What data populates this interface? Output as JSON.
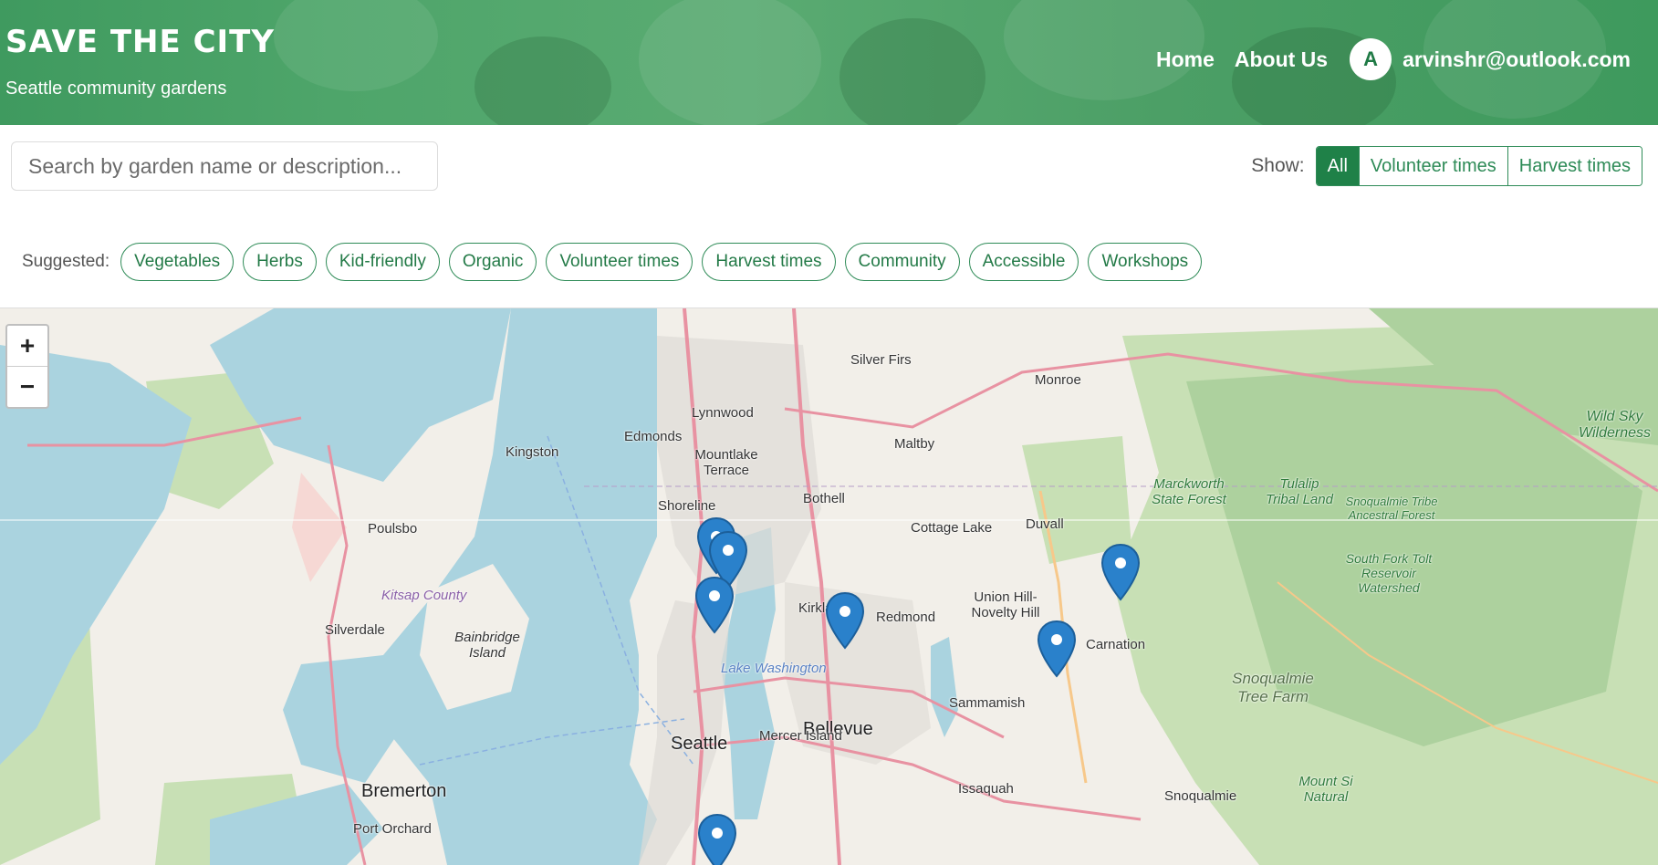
{
  "header": {
    "title": "Save the City",
    "subtitle": "Seattle community gardens",
    "nav": [
      {
        "label": "Home"
      },
      {
        "label": "About Us"
      }
    ],
    "user": {
      "initial": "A",
      "email": "arvinshr@outlook.com"
    }
  },
  "search": {
    "placeholder": "Search by garden name or description..."
  },
  "filter": {
    "label": "Show:",
    "options": [
      {
        "label": "All",
        "active": true
      },
      {
        "label": "Volunteer times",
        "active": false
      },
      {
        "label": "Harvest times",
        "active": false
      }
    ]
  },
  "suggested": {
    "label": "Suggested:",
    "tags": [
      "Vegetables",
      "Herbs",
      "Kid-friendly",
      "Organic",
      "Volunteer times",
      "Harvest times",
      "Community",
      "Accessible",
      "Workshops"
    ]
  },
  "map": {
    "zoom_in": "+",
    "zoom_out": "−",
    "places": {
      "seattle": "Seattle",
      "bellevue": "Bellevue",
      "bremerton": "Bremerton",
      "lynnwood": "Lynnwood",
      "edmonds": "Edmonds",
      "mountlake_terrace": "Mountlake Terrace",
      "shoreline": "Shoreline",
      "bothell": "Bothell",
      "kingston": "Kingston",
      "poulsbo": "Poulsbo",
      "silverdale": "Silverdale",
      "bainbridge_island": "Bainbridge Island",
      "kirkland": "Kirkland",
      "redmond": "Redmond",
      "mercer_island": "Mercer Island",
      "sammamish": "Sammamish",
      "issaquah": "Issaquah",
      "silver_firs": "Silver Firs",
      "monroe": "Monroe",
      "maltby": "Maltby",
      "cottage_lake": "Cottage Lake",
      "duvall": "Duvall",
      "union_hill": "Union Hill-Novelty Hill",
      "carnation": "Carnation",
      "snoqualmie": "Snoqualmie",
      "port_orchard": "Port Orchard",
      "kitsap_county": "Kitsap County",
      "lake_washington": "Lake Washington",
      "marckworth": "Marckworth State Forest",
      "tulalip": "Tulalip Tribal Land",
      "snoqualmie_tribe": "Snoqualmie Tribe Ancestral Forest",
      "south_fork": "South Fork Tolt Reservoir Watershed",
      "snoqualmie_tree_farm": "Snoqualmie Tree Farm",
      "wild_sky": "Wild Sky Wilderness",
      "mount_si": "Mount Si Natural"
    },
    "marker_count": 8
  },
  "colors": {
    "brand_green": "#1f8148",
    "header_green": "#4ea56a",
    "water": "#aad3df",
    "forest": "#add19e",
    "marker": "#2a81cb"
  }
}
